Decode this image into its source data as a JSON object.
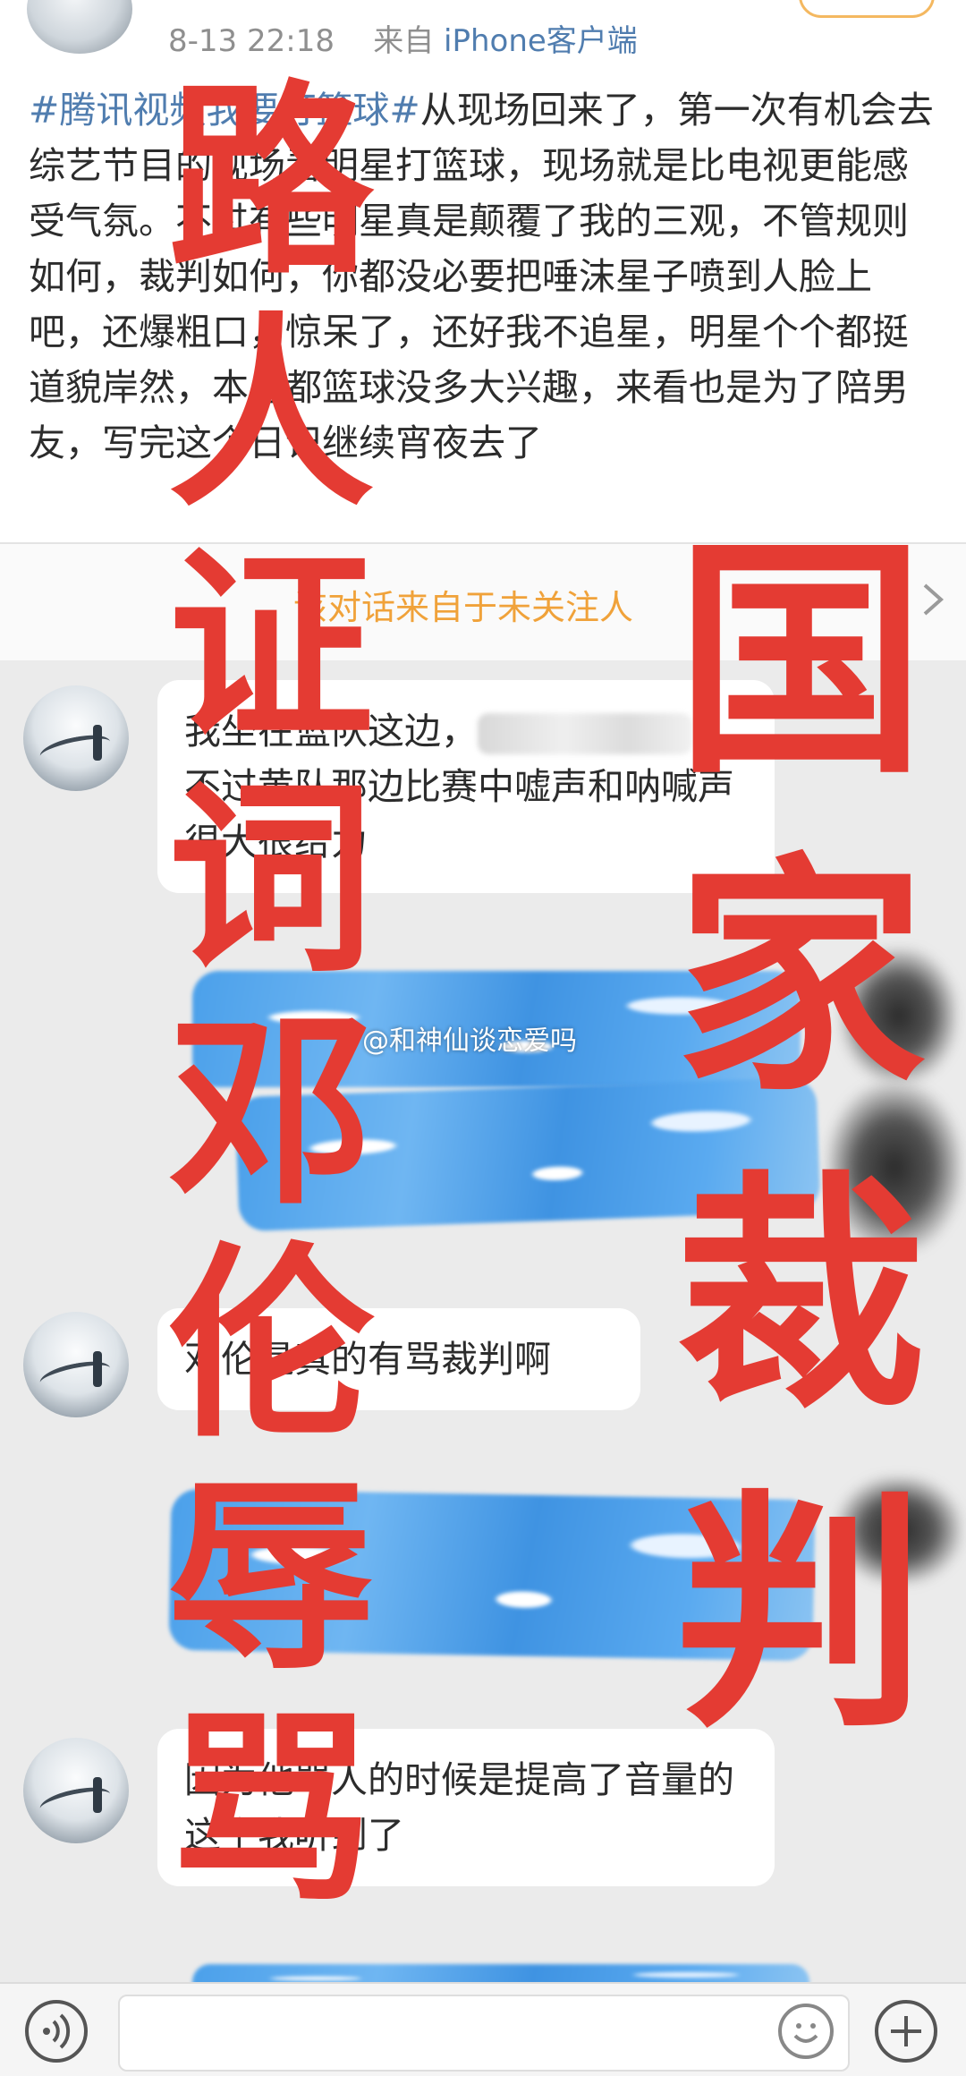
{
  "post": {
    "time": "8-13 22:18",
    "source_prefix": "来自 ",
    "source": "iPhone客户端",
    "hashtag": "#腾讯视频我要打篮球#",
    "text": "从现场回来了，第一次有机会去综艺节目的现场看明星打篮球，现场就是比电视更能感受气氛。不过有些明星真是颠覆了我的三观，不管规则如何，裁判如何，你都没必要把唾沫星子喷到人脸上吧，还爆粗口，惊呆了，还好我不追星，明星个个都挺道貌岸然，本身都篮球没多大兴趣，来看也是为了陪男友，写完这个日记继续宵夜去了"
  },
  "stranger_bar": {
    "text": "该对话来自于未关注人"
  },
  "messages": [
    {
      "text_a": "我坐在蓝队这边，",
      "text_b": "，不过黄队那边比赛中嘘声和呐喊声很大很给力"
    },
    {
      "text": "邓伦是真的有骂裁判啊"
    },
    {
      "text": "因为他骂人的时候是提高了音量的这个我听到了"
    }
  ],
  "watermark": "@和神仙谈恋爱吗",
  "overlay": {
    "left": [
      "路",
      "人",
      "证",
      "词",
      "邓",
      "伦",
      "辱",
      "骂"
    ],
    "right": [
      "国",
      "家",
      "裁",
      "判"
    ]
  },
  "colors": {
    "link": "#507daf",
    "stranger": "#f0a23a",
    "overlay_red": "#e43b33",
    "scribble_blue": "#4ba0ea"
  },
  "icons": [
    "voice-icon",
    "emoji-icon",
    "plus-icon",
    "chevron-right-icon"
  ]
}
